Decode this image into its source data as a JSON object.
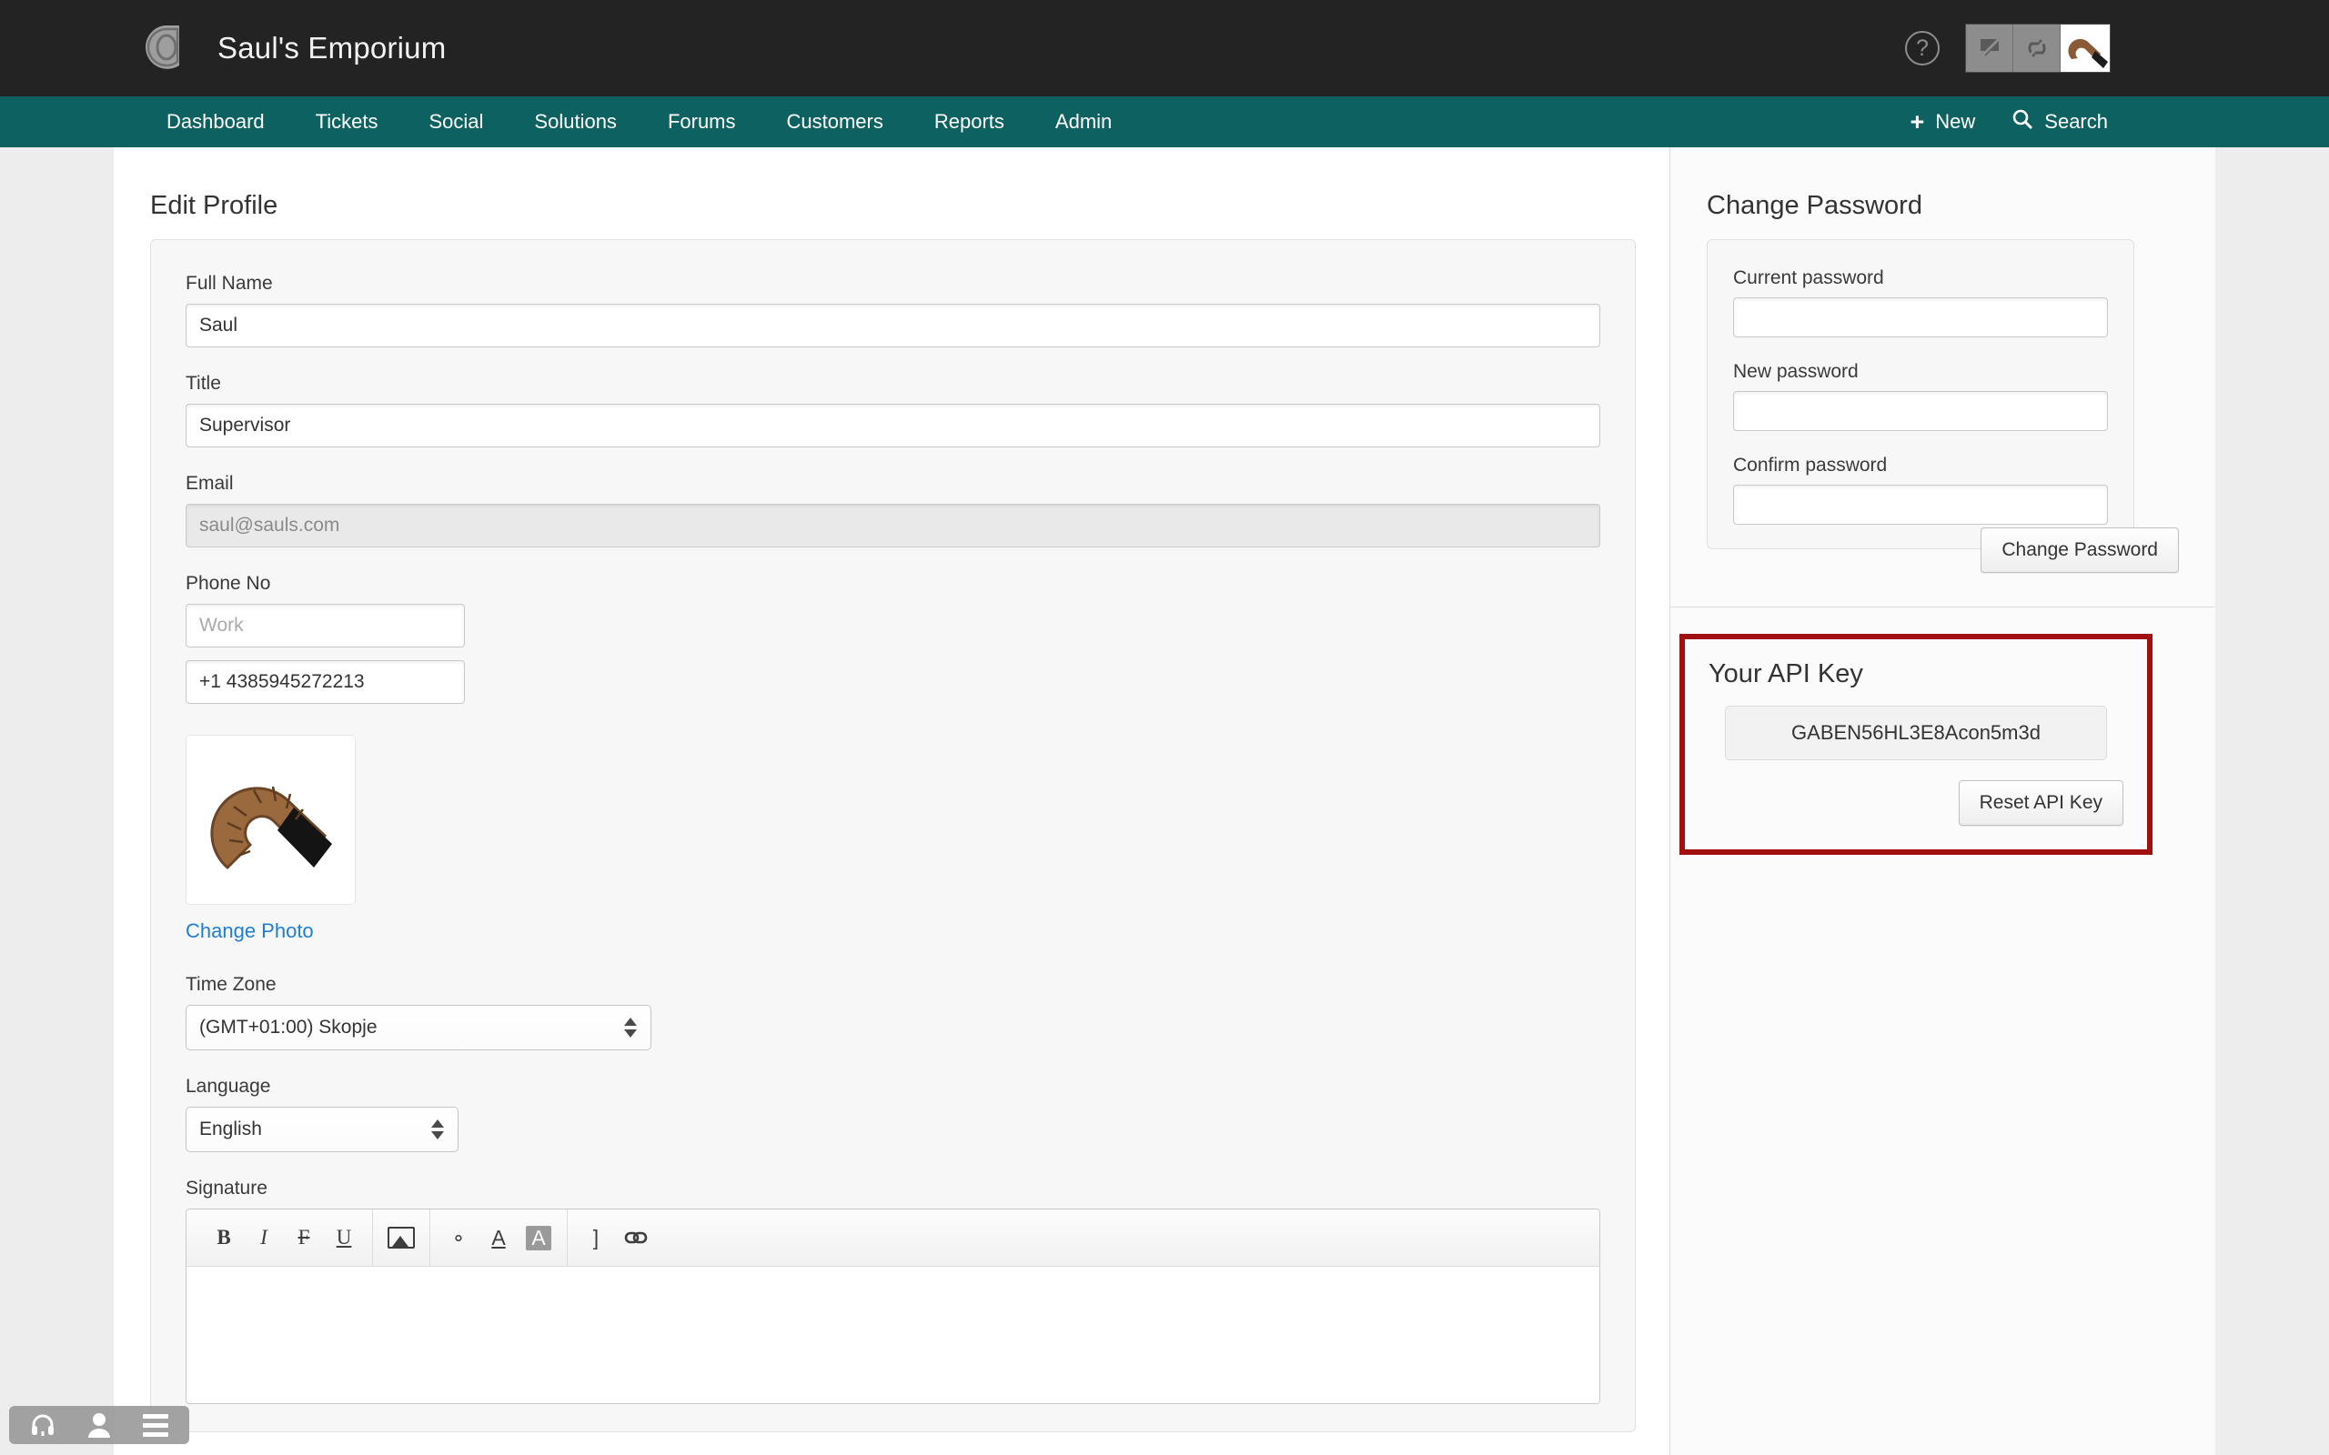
{
  "header": {
    "brand_title": "Saul's Emporium",
    "logo_icon": "ring-logo-icon",
    "help_icon": "help-circle-icon",
    "help_glyph": "?",
    "toggles": [
      {
        "icon": "chat-off-icon"
      },
      {
        "icon": "refresh-off-icon"
      }
    ],
    "avatar_icon": "user-avatar-cane-image"
  },
  "nav": {
    "items": [
      {
        "label": "Dashboard"
      },
      {
        "label": "Tickets"
      },
      {
        "label": "Social"
      },
      {
        "label": "Solutions"
      },
      {
        "label": "Forums"
      },
      {
        "label": "Customers"
      },
      {
        "label": "Reports"
      },
      {
        "label": "Admin"
      }
    ],
    "new_label": "New",
    "new_icon": "plus-icon",
    "search_label": "Search",
    "search_icon": "search-icon"
  },
  "profile": {
    "title": "Edit Profile",
    "fields": {
      "full_name": {
        "label": "Full Name",
        "value": "Saul",
        "placeholder": ""
      },
      "title": {
        "label": "Title",
        "value": "Supervisor",
        "placeholder": ""
      },
      "email": {
        "label": "Email",
        "value": "saul@sauls.com",
        "placeholder": "",
        "disabled": "true"
      },
      "phone": {
        "label": "Phone No",
        "work_value": "",
        "work_placeholder": "Work",
        "mobile_value": "+1 4385945272213",
        "mobile_placeholder": ""
      },
      "time_zone": {
        "label": "Time Zone",
        "value": "(GMT+01:00) Skopje"
      },
      "language": {
        "label": "Language",
        "value": "English"
      },
      "signature": {
        "label": "Signature",
        "value": ""
      }
    },
    "photo": {
      "change_label": "Change Photo",
      "image_icon": "profile-photo-cane-image"
    },
    "editor_toolbar": [
      {
        "icon": "bold-icon",
        "glyph": "B"
      },
      {
        "icon": "italic-icon",
        "glyph": "I"
      },
      {
        "icon": "strikethrough-icon",
        "glyph": "F"
      },
      {
        "icon": "underline-icon",
        "glyph": "U"
      },
      {
        "icon": "insert-image-icon",
        "glyph": ""
      },
      {
        "icon": "background-color-icon",
        "glyph": "∘"
      },
      {
        "icon": "font-color-icon",
        "glyph": "A"
      },
      {
        "icon": "highlight-color-icon",
        "glyph": "A"
      },
      {
        "icon": "clear-format-icon",
        "glyph": "]"
      },
      {
        "icon": "insert-link-icon",
        "glyph": "∞"
      }
    ]
  },
  "password": {
    "title": "Change Password",
    "current": {
      "label": "Current password",
      "value": ""
    },
    "new": {
      "label": "New password",
      "value": ""
    },
    "confirm": {
      "label": "Confirm password",
      "value": ""
    },
    "submit_label": "Change Password"
  },
  "api": {
    "title": "Your API Key",
    "key": "GABEN56HL3E8Acon5m3d",
    "reset_label": "Reset API Key",
    "highlight_color": "#a01010"
  },
  "dock": {
    "items": [
      {
        "icon": "headset-icon"
      },
      {
        "icon": "person-icon"
      },
      {
        "icon": "hamburger-menu-icon"
      }
    ]
  },
  "colors": {
    "header_bg": "#232323",
    "nav_bg": "#0d6160",
    "link": "#1d7fd4"
  }
}
